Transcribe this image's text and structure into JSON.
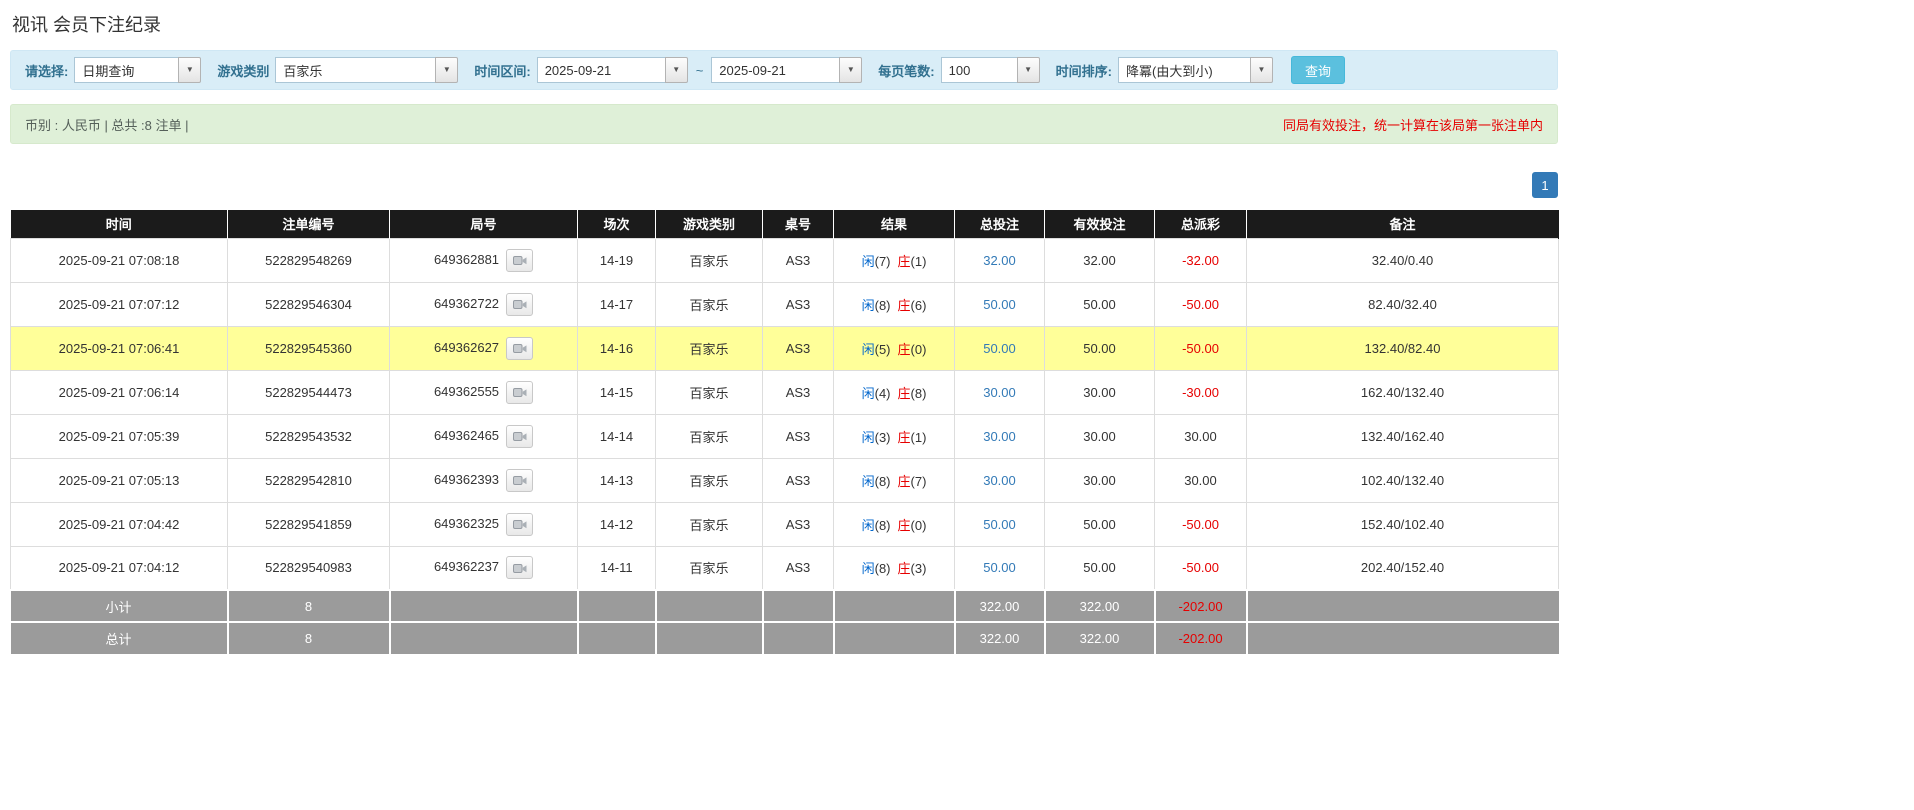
{
  "page": {
    "title": "视讯 会员下注纪录"
  },
  "icons": {
    "chevron_down": "▼"
  },
  "colors": {
    "accent_blue": "#337ab7",
    "player_blue": "#0066cc",
    "negative_red": "#e60000",
    "highlight_yellow": "#ffff99",
    "header_black": "#1b1b1b",
    "footer_gray": "#9b9b9b",
    "filter_bar_blue": "#d9edf7",
    "summary_bar_green": "#dff0d8"
  },
  "filters": {
    "select_label": "请选择:",
    "select_value": "日期查询",
    "game_type_label": "游戏类别",
    "game_type_value": "百家乐",
    "time_range_label": "时间区间:",
    "date_from": "2025-09-21",
    "date_separator": "~",
    "date_to": "2025-09-21",
    "page_size_label": "每页笔数:",
    "page_size_value": "100",
    "sort_label": "时间排序:",
    "sort_value": "降冪(由大到小)",
    "search_button_label": "查询"
  },
  "summary": {
    "left_text": "币别 : 人民币 | 总共 :8 注单 |",
    "right_notice": "同局有效投注，统一计算在该局第一张注单内"
  },
  "pagination": {
    "current_page": "1"
  },
  "table": {
    "headers": [
      "时间",
      "注单编号",
      "局号",
      "场次",
      "游戏类别",
      "桌号",
      "结果",
      "总投注",
      "有效投注",
      "总派彩",
      "备注"
    ],
    "rows": [
      {
        "time": "2025-09-21 07:08:18",
        "bet_id": "522829548269",
        "round_id": "649362881",
        "session": "14-19",
        "game_type": "百家乐",
        "table_no": "AS3",
        "result_player": "闲",
        "result_player_count": "(7)",
        "result_banker": "庄",
        "result_banker_count": "(1)",
        "total_bet": "32.00",
        "valid_bet": "32.00",
        "payout": "-32.00",
        "note": "32.40/0.40",
        "highlighted": false
      },
      {
        "time": "2025-09-21 07:07:12",
        "bet_id": "522829546304",
        "round_id": "649362722",
        "session": "14-17",
        "game_type": "百家乐",
        "table_no": "AS3",
        "result_player": "闲",
        "result_player_count": "(8)",
        "result_banker": "庄",
        "result_banker_count": "(6)",
        "total_bet": "50.00",
        "valid_bet": "50.00",
        "payout": "-50.00",
        "note": "82.40/32.40",
        "highlighted": false
      },
      {
        "time": "2025-09-21 07:06:41",
        "bet_id": "522829545360",
        "round_id": "649362627",
        "session": "14-16",
        "game_type": "百家乐",
        "table_no": "AS3",
        "result_player": "闲",
        "result_player_count": "(5)",
        "result_banker": "庄",
        "result_banker_count": "(0)",
        "total_bet": "50.00",
        "valid_bet": "50.00",
        "payout": "-50.00",
        "note": "132.40/82.40",
        "highlighted": true
      },
      {
        "time": "2025-09-21 07:06:14",
        "bet_id": "522829544473",
        "round_id": "649362555",
        "session": "14-15",
        "game_type": "百家乐",
        "table_no": "AS3",
        "result_player": "闲",
        "result_player_count": "(4)",
        "result_banker": "庄",
        "result_banker_count": "(8)",
        "total_bet": "30.00",
        "valid_bet": "30.00",
        "payout": "-30.00",
        "note": "162.40/132.40",
        "highlighted": false
      },
      {
        "time": "2025-09-21 07:05:39",
        "bet_id": "522829543532",
        "round_id": "649362465",
        "session": "14-14",
        "game_type": "百家乐",
        "table_no": "AS3",
        "result_player": "闲",
        "result_player_count": "(3)",
        "result_banker": "庄",
        "result_banker_count": "(1)",
        "total_bet": "30.00",
        "valid_bet": "30.00",
        "payout": "30.00",
        "note": "132.40/162.40",
        "highlighted": false
      },
      {
        "time": "2025-09-21 07:05:13",
        "bet_id": "522829542810",
        "round_id": "649362393",
        "session": "14-13",
        "game_type": "百家乐",
        "table_no": "AS3",
        "result_player": "闲",
        "result_player_count": "(8)",
        "result_banker": "庄",
        "result_banker_count": "(7)",
        "total_bet": "30.00",
        "valid_bet": "30.00",
        "payout": "30.00",
        "note": "102.40/132.40",
        "highlighted": false
      },
      {
        "time": "2025-09-21 07:04:42",
        "bet_id": "522829541859",
        "round_id": "649362325",
        "session": "14-12",
        "game_type": "百家乐",
        "table_no": "AS3",
        "result_player": "闲",
        "result_player_count": "(8)",
        "result_banker": "庄",
        "result_banker_count": "(0)",
        "total_bet": "50.00",
        "valid_bet": "50.00",
        "payout": "-50.00",
        "note": "152.40/102.40",
        "highlighted": false
      },
      {
        "time": "2025-09-21 07:04:12",
        "bet_id": "522829540983",
        "round_id": "649362237",
        "session": "14-11",
        "game_type": "百家乐",
        "table_no": "AS3",
        "result_player": "闲",
        "result_player_count": "(8)",
        "result_banker": "庄",
        "result_banker_count": "(3)",
        "total_bet": "50.00",
        "valid_bet": "50.00",
        "payout": "-50.00",
        "note": "202.40/152.40",
        "highlighted": false
      }
    ],
    "subtotal": {
      "label": "小计",
      "count": "8",
      "total_bet": "322.00",
      "valid_bet": "322.00",
      "payout": "-202.00"
    },
    "total": {
      "label": "总计",
      "count": "8",
      "total_bet": "322.00",
      "valid_bet": "322.00",
      "payout": "-202.00"
    }
  }
}
